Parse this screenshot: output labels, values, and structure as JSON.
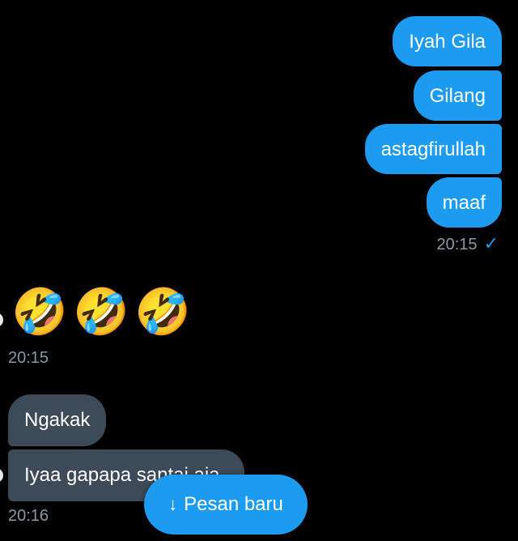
{
  "colors": {
    "background": "#000000",
    "outgoing_bubble": "#1d9bf0",
    "incoming_bubble": "#3d4a58",
    "timestamp": "#8b98a5",
    "accent": "#1d9bf0"
  },
  "messages": {
    "outgoing": [
      {
        "text": "Iyah Gila"
      },
      {
        "text": "Gilang"
      },
      {
        "text": "astagfirullah"
      },
      {
        "text": "maaf"
      }
    ],
    "outgoing_time": "20:15",
    "outgoing_status_icon": "check-icon",
    "outgoing_status_glyph": "✓",
    "emoji_message": {
      "emojis": [
        "🤣",
        "🤣",
        "🤣"
      ],
      "time": "20:15"
    },
    "incoming": [
      {
        "text": "Ngakak"
      },
      {
        "text": "Iyaa gapapa santai aja"
      }
    ],
    "incoming_time": "20:16"
  },
  "new_messages_button": {
    "icon": "arrow-down-icon",
    "icon_glyph": "↓",
    "label": "Pesan baru"
  }
}
